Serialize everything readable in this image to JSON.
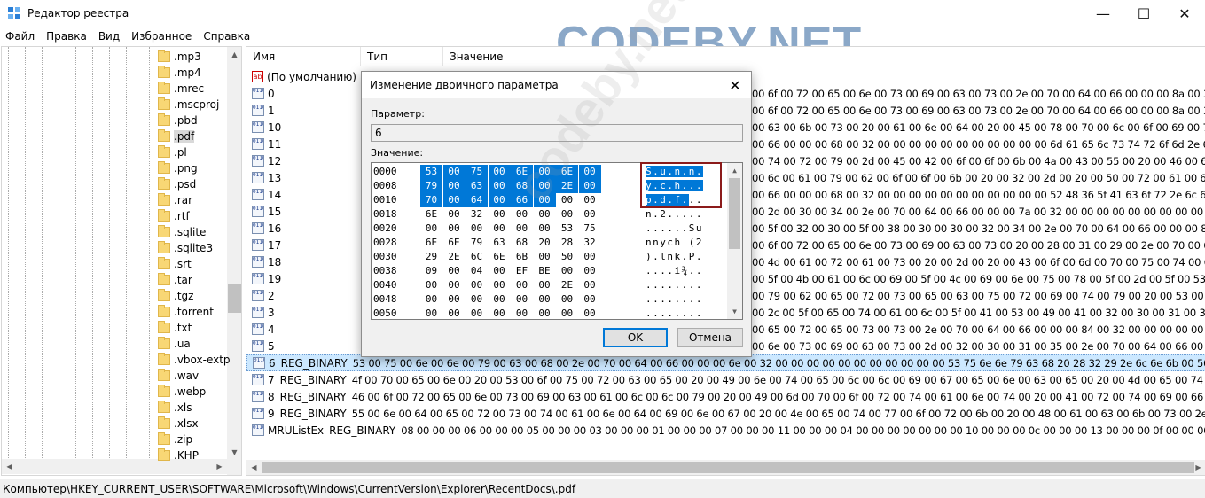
{
  "window": {
    "title": "Редактор реестра",
    "logo": "CODEBY.NET",
    "minimize": "—",
    "maximize": "☐",
    "close": "✕"
  },
  "menu": [
    "Файл",
    "Правка",
    "Вид",
    "Избранное",
    "Справка"
  ],
  "tree": {
    "items": [
      ".mp3",
      ".mp4",
      ".mrec",
      ".mscproj",
      ".pbd",
      ".pdf",
      ".pl",
      ".png",
      ".psd",
      ".rar",
      ".rtf",
      ".sqlite",
      ".sqlite3",
      ".srt",
      ".tar",
      ".tgz",
      ".torrent",
      ".txt",
      ".ua",
      ".vbox-extp",
      ".wav",
      ".webp",
      ".xls",
      ".xlsx",
      ".zip",
      ".KHP"
    ],
    "selected_index": 5
  },
  "list": {
    "columns": [
      "Имя",
      "Тип",
      "Значение"
    ],
    "rows": [
      {
        "name": "(По умолчанию)",
        "type": "",
        "value": "",
        "icon": "string-value-icon"
      },
      {
        "name": "0",
        "type": "",
        "value": "",
        "icon": "binary-value-icon"
      },
      {
        "name": "1",
        "type": "",
        "value": "",
        "icon": "binary-value-icon"
      },
      {
        "name": "10",
        "type": "",
        "value": "",
        "icon": "binary-value-icon"
      },
      {
        "name": "11",
        "type": "",
        "value": "",
        "icon": "binary-value-icon"
      },
      {
        "name": "12",
        "type": "",
        "value": "",
        "icon": "binary-value-icon"
      },
      {
        "name": "13",
        "type": "",
        "value": "",
        "icon": "binary-value-icon"
      },
      {
        "name": "14",
        "type": "",
        "value": "",
        "icon": "binary-value-icon"
      },
      {
        "name": "15",
        "type": "",
        "value": "",
        "icon": "binary-value-icon"
      },
      {
        "name": "16",
        "type": "",
        "value": "",
        "icon": "binary-value-icon"
      },
      {
        "name": "17",
        "type": "",
        "value": "",
        "icon": "binary-value-icon"
      },
      {
        "name": "18",
        "type": "",
        "value": "",
        "icon": "binary-value-icon"
      },
      {
        "name": "19",
        "type": "",
        "value": "",
        "icon": "binary-value-icon"
      },
      {
        "name": "2",
        "type": "",
        "value": "",
        "icon": "binary-value-icon"
      },
      {
        "name": "3",
        "type": "",
        "value": "",
        "icon": "binary-value-icon"
      },
      {
        "name": "4",
        "type": "",
        "value": "",
        "icon": "binary-value-icon"
      },
      {
        "name": "5",
        "type": "",
        "value": "",
        "icon": "binary-value-icon"
      },
      {
        "name": "6",
        "type": "REG_BINARY",
        "value": "53 00 75 00 6e 00 6e 00 79 00 63 00 68 00 2e 00 70 00 64 00 66 00 00 00 6e 00 32 00 00 00 00 00 00 00 00 00 00 00 53 75 6e 6e 79 63 68 20 28 32 29 2e 6c 6e 6b 00 50 00 09",
        "icon": "binary-value-icon"
      },
      {
        "name": "7",
        "type": "REG_BINARY",
        "value": "4f 00 70 00 65 00 6e 00 20 00 53 00 6f 00 75 00 72 00 63 00 65 00 20 00 49 00 6e 00 74 00 65 00 6c 00 6c 00 69 00 67 00 65 00 6e 00 63 00 65 00 20 00 4d 00 65 00 74 68",
        "icon": "binary-value-icon"
      },
      {
        "name": "8",
        "type": "REG_BINARY",
        "value": "46 00 6f 00 72 00 65 00 6e 00 73 00 69 00 63 00 61 00 6c 00 6c 00 79 00 20 00 49 00 6d 00 70 00 6f 00 72 00 74 00 61 00 6e 00 74 00 20 00 41 00 72 00 74 00 69 00 66 00 61",
        "icon": "binary-value-icon"
      },
      {
        "name": "9",
        "type": "REG_BINARY",
        "value": "55 00 6e 00 64 00 65 00 72 00 73 00 74 00 61 00 6e 00 64 00 69 00 6e 00 67 00 20 00 4e 00 65 00 74 00 77 00 6f 00 72 00 6b 00 20 00 48 00 61 00 63 00 6b 00 73 00 2e 00 70",
        "icon": "binary-value-icon"
      },
      {
        "name": "MRUListEx",
        "type": "REG_BINARY",
        "value": "08 00 00 00 06 00 00 00 05 00 00 00 03 00 00 00 01 00 00 00 07 00 00 00 11 00 00 00 04 00 00 00 00 00 00 00 10 00 00 00 0c 00 00 00 13 00 00 00 0f 00 00 00 0e",
        "icon": "binary-value-icon"
      }
    ],
    "selected_index": 17,
    "visible_hex_tails": [
      "00 6f 00 72 00 65 00 6e 00 73 00 69 00 63 00 73 00 2e 00 70 00 64 00 66 00 00 00 8a 00 32 00 00 00 00",
      "00 6f 00 72 00 65 00 6e 00 73 00 69 00 63 00 73 00 2e 00 70 00 64 00 66 00 00 00 8a 00 32 00 00 00 00",
      "00 63 00 6b 00 73 00 20 00 61 00 6e 00 64 00 20 00 45 00 78 00 70 00 6c 00 6f 00 69 00 74 00 61 00 74",
      "00 66 00 00 00 68 00 32 00 00 00 00 00 00 00 00 00 00 00 6d 61 65 6c 73 74 72 6f 6d 2e 6c 6e 6b 00 4c",
      "00 74 00 72 00 79 00 2d 00 45 00 42 00 6f 00 6f 00 6b 00 4a 00 43 00 55 00 20 00 46 00 69 00 6e 00 61",
      "00 6c 00 61 00 79 00 62 00 6f 00 6f 00 6b 00 20 00 32 00 2d 00 20 00 50 00 72 00 61 00 63 00 74 00 69",
      "00 66 00 00 00 68 00 32 00 00 00 00 00 00 00 00 00 00 00 52 48 36 5f 41 63 6f 72 2e 6c 6e 6b 00 4c",
      "00 2d 00 30 00 34 00 2e 00 70 00 64 00 66 00 00 00 7a 00 32 00 00 00 00 00 00 00 00 00 00 00 52 48 5",
      "00 5f 00 32 00 30 00 5f 00 38 00 30 00 30 00 32 00 34 00 2e 00 70 00 64 00 66 00 00 00 8c 00 32 00 00",
      "00 6f 00 72 00 65 00 6e 00 73 00 69 00 63 00 73 00 20 00 28 00 31 00 29 00 2e 00 70 00 64 00 66 00 00",
      "00 4d 00 61 00 72 00 61 00 73 00 20 00 2d 00 20 00 43 00 6f 00 6d 00 70 00 75 00 74 00 65 00 72 00 20",
      "00 5f 00 4b 00 61 00 6c 00 69 00 5f 00 4c 00 69 00 6e 00 75 00 78 00 5f 00 2d 00 5f 00 53 00 6c 00 65",
      "00 79 00 62 00 65 00 72 00 73 00 65 00 63 00 75 00 72 00 69 00 74 00 79 00 20 00 53 00 74 00 75 00 64",
      "00 2c 00 5f 00 65 00 74 00 61 00 6c 00 5f 00 41 00 53 00 49 00 41 00 32 00 30 00 31 00 36 00 2e 00 70",
      "00 65 00 72 00 65 00 73 00 73 00 2e 00 70 00 64 00 66 00 00 00 84 00 32 00 00 00 00 00 00 00 00 00 00",
      "00 6e 00 73 00 69 00 63 00 73 00 2d 00 32 00 30 00 31 00 35 00 2e 00 70 00 64 00 66 00 00 00 90 00 32"
    ]
  },
  "status": {
    "path": "Компьютер\\HKEY_CURRENT_USER\\SOFTWARE\\Microsoft\\Windows\\CurrentVersion\\Explorer\\RecentDocs\\.pdf"
  },
  "dialog": {
    "title": "Изменение двоичного параметра",
    "param_label": "Параметр:",
    "param_value": "6",
    "value_label": "Значение:",
    "ok": "OK",
    "cancel": "Отмена",
    "watermark": "codeby.net",
    "hex_rows": [
      {
        "offset": "0000",
        "bytes": [
          "53",
          "00",
          "75",
          "00",
          "6E",
          "00",
          "6E",
          "00"
        ],
        "ascii": "S.u.n.n."
      },
      {
        "offset": "0008",
        "bytes": [
          "79",
          "00",
          "63",
          "00",
          "68",
          "00",
          "2E",
          "00"
        ],
        "ascii": "y.c.h..."
      },
      {
        "offset": "0010",
        "bytes": [
          "70",
          "00",
          "64",
          "00",
          "66",
          "00",
          "00",
          "00"
        ],
        "ascii": "p.d.f..."
      },
      {
        "offset": "0018",
        "bytes": [
          "6E",
          "00",
          "32",
          "00",
          "00",
          "00",
          "00",
          "00"
        ],
        "ascii": "n.2....."
      },
      {
        "offset": "0020",
        "bytes": [
          "00",
          "00",
          "00",
          "00",
          "00",
          "00",
          "53",
          "75"
        ],
        "ascii": "......Su"
      },
      {
        "offset": "0028",
        "bytes": [
          "6E",
          "6E",
          "79",
          "63",
          "68",
          "20",
          "28",
          "32"
        ],
        "ascii": "nnych (2"
      },
      {
        "offset": "0030",
        "bytes": [
          "29",
          "2E",
          "6C",
          "6E",
          "6B",
          "00",
          "50",
          "00"
        ],
        "ascii": ").lnk.P."
      },
      {
        "offset": "0038",
        "bytes": [
          "09",
          "00",
          "04",
          "00",
          "EF",
          "BE",
          "00",
          "00"
        ],
        "ascii": "....i¾.."
      },
      {
        "offset": "0040",
        "bytes": [
          "00",
          "00",
          "00",
          "00",
          "00",
          "00",
          "2E",
          "00"
        ],
        "ascii": "........"
      },
      {
        "offset": "0048",
        "bytes": [
          "00",
          "00",
          "00",
          "00",
          "00",
          "00",
          "00",
          "00"
        ],
        "ascii": "........"
      },
      {
        "offset": "0050",
        "bytes": [
          "00",
          "00",
          "00",
          "00",
          "00",
          "00",
          "00",
          "00"
        ],
        "ascii": "........"
      }
    ],
    "selected_byte_count": 22
  },
  "colors": {
    "selection": "#0078d7",
    "highlight_box": "#8b1a1a",
    "logo": "#8ba8c8",
    "row_selected": "#cce8ff"
  }
}
